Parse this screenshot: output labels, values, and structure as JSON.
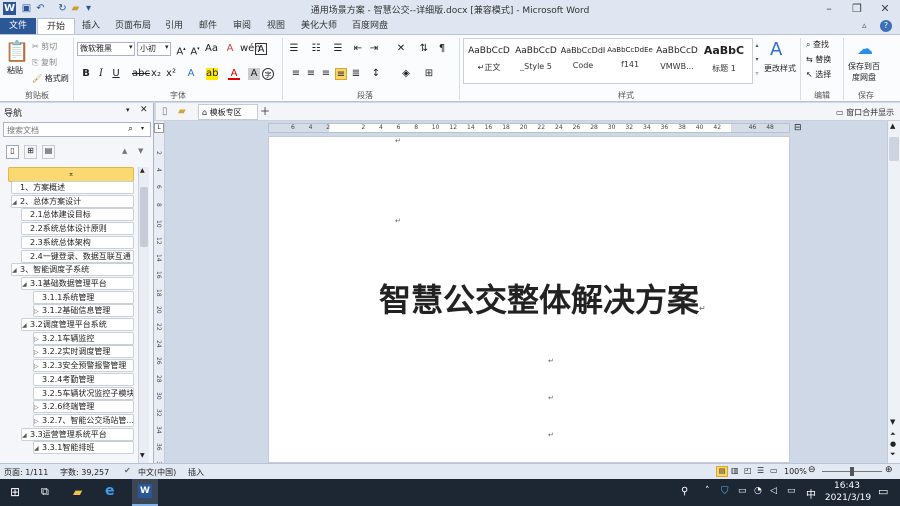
{
  "window": {
    "title": "通用场景方案 - 智慧公交--详细版.docx [兼容模式] - Microsoft Word"
  },
  "ribbon_tabs": [
    "文件",
    "开始",
    "插入",
    "页面布局",
    "引用",
    "邮件",
    "审阅",
    "视图",
    "美化大师",
    "百度网盘"
  ],
  "clipboard": {
    "paste": "粘贴",
    "cut": "剪切",
    "copy": "复制",
    "format_painter": "格式刷",
    "group": "剪贴板"
  },
  "font": {
    "name": "微软雅黑",
    "size": "小初",
    "group": "字体"
  },
  "paragraph": {
    "group": "段落"
  },
  "styles": {
    "items": [
      {
        "preview": "AaBbCcD",
        "name": "↵正文"
      },
      {
        "preview": "AaBbCcD",
        "name": "_Style 5"
      },
      {
        "preview": "AaBbCcDdI",
        "name": "Code"
      },
      {
        "preview": "AaBbCcDdEe",
        "name": "f141"
      },
      {
        "preview": "AaBbCcD",
        "name": "VMWB..."
      },
      {
        "preview": "AaBbC",
        "name": "标题 1"
      }
    ],
    "change_styles": "更改样式",
    "group": "样式"
  },
  "editing": {
    "find": "查找",
    "replace": "替换",
    "select": "选择",
    "group": "编辑"
  },
  "save": {
    "label_line1": "保存到百",
    "label_line2": "度网盘",
    "group": "保存"
  },
  "doc_strip": {
    "template_tab": "模板专区",
    "window_merge": "窗口合并显示"
  },
  "nav_pane": {
    "title": "导航",
    "search_placeholder": "搜索文档",
    "items": [
      {
        "text": "1、方案概述",
        "level": 1,
        "expand": ""
      },
      {
        "text": "2、总体方案设计",
        "level": 1,
        "expand": "◢"
      },
      {
        "text": "2.1总体建设目标",
        "level": 2,
        "expand": ""
      },
      {
        "text": "2.2系统总体设计原则",
        "level": 2,
        "expand": ""
      },
      {
        "text": "2.3系统总体架构",
        "level": 2,
        "expand": ""
      },
      {
        "text": "2.4一键登录、数据互联互通",
        "level": 2,
        "expand": ""
      },
      {
        "text": "3、智能调度子系统",
        "level": 1,
        "expand": "◢"
      },
      {
        "text": "3.1基础数据管理平台",
        "level": 2,
        "expand": "◢"
      },
      {
        "text": "3.1.1系统管理",
        "level": 3,
        "expand": ""
      },
      {
        "text": "3.1.2基础信息管理",
        "level": 3,
        "expand": "▷"
      },
      {
        "text": "3.2调度管理平台系统",
        "level": 2,
        "expand": "◢"
      },
      {
        "text": "3.2.1车辆监控",
        "level": 3,
        "expand": "▷"
      },
      {
        "text": "3.2.2实时调度管理",
        "level": 3,
        "expand": "▷"
      },
      {
        "text": "3.2.3安全预警报警管理",
        "level": 3,
        "expand": "▷"
      },
      {
        "text": "3.2.4考勤管理",
        "level": 3,
        "expand": ""
      },
      {
        "text": "3.2.5车辆状况监控子模块",
        "level": 3,
        "expand": ""
      },
      {
        "text": "3.2.6终端管理",
        "level": 3,
        "expand": "▷"
      },
      {
        "text": "3.2.7、智能公交场站管...",
        "level": 3,
        "expand": "▷"
      },
      {
        "text": "3.3运营管理系统平台",
        "level": 2,
        "expand": "◢"
      },
      {
        "text": "3.3.1智能排班",
        "level": 3,
        "expand": "◢"
      }
    ]
  },
  "ruler_numbers": [
    "6",
    "4",
    "2",
    "",
    "2",
    "4",
    "6",
    "8",
    "10",
    "12",
    "14",
    "16",
    "18",
    "20",
    "22",
    "24",
    "26",
    "28",
    "30",
    "32",
    "34",
    "36",
    "38",
    "40",
    "42",
    "",
    "46",
    "48"
  ],
  "vruler_numbers": [
    "2",
    "4",
    "6",
    "8",
    "10",
    "12",
    "14",
    "16",
    "18",
    "20",
    "22",
    "24",
    "26",
    "28",
    "30",
    "32",
    "34",
    "36",
    "38"
  ],
  "document": {
    "heading": "智慧公交整体解决方案"
  },
  "statusbar": {
    "page": "页面: 1/111",
    "words": "字数: 39,257",
    "language": "中文(中国)",
    "mode": "插入",
    "zoom": "100%"
  },
  "taskbar": {
    "ime": "中",
    "time": "16:43",
    "date": "2021/3/19"
  }
}
